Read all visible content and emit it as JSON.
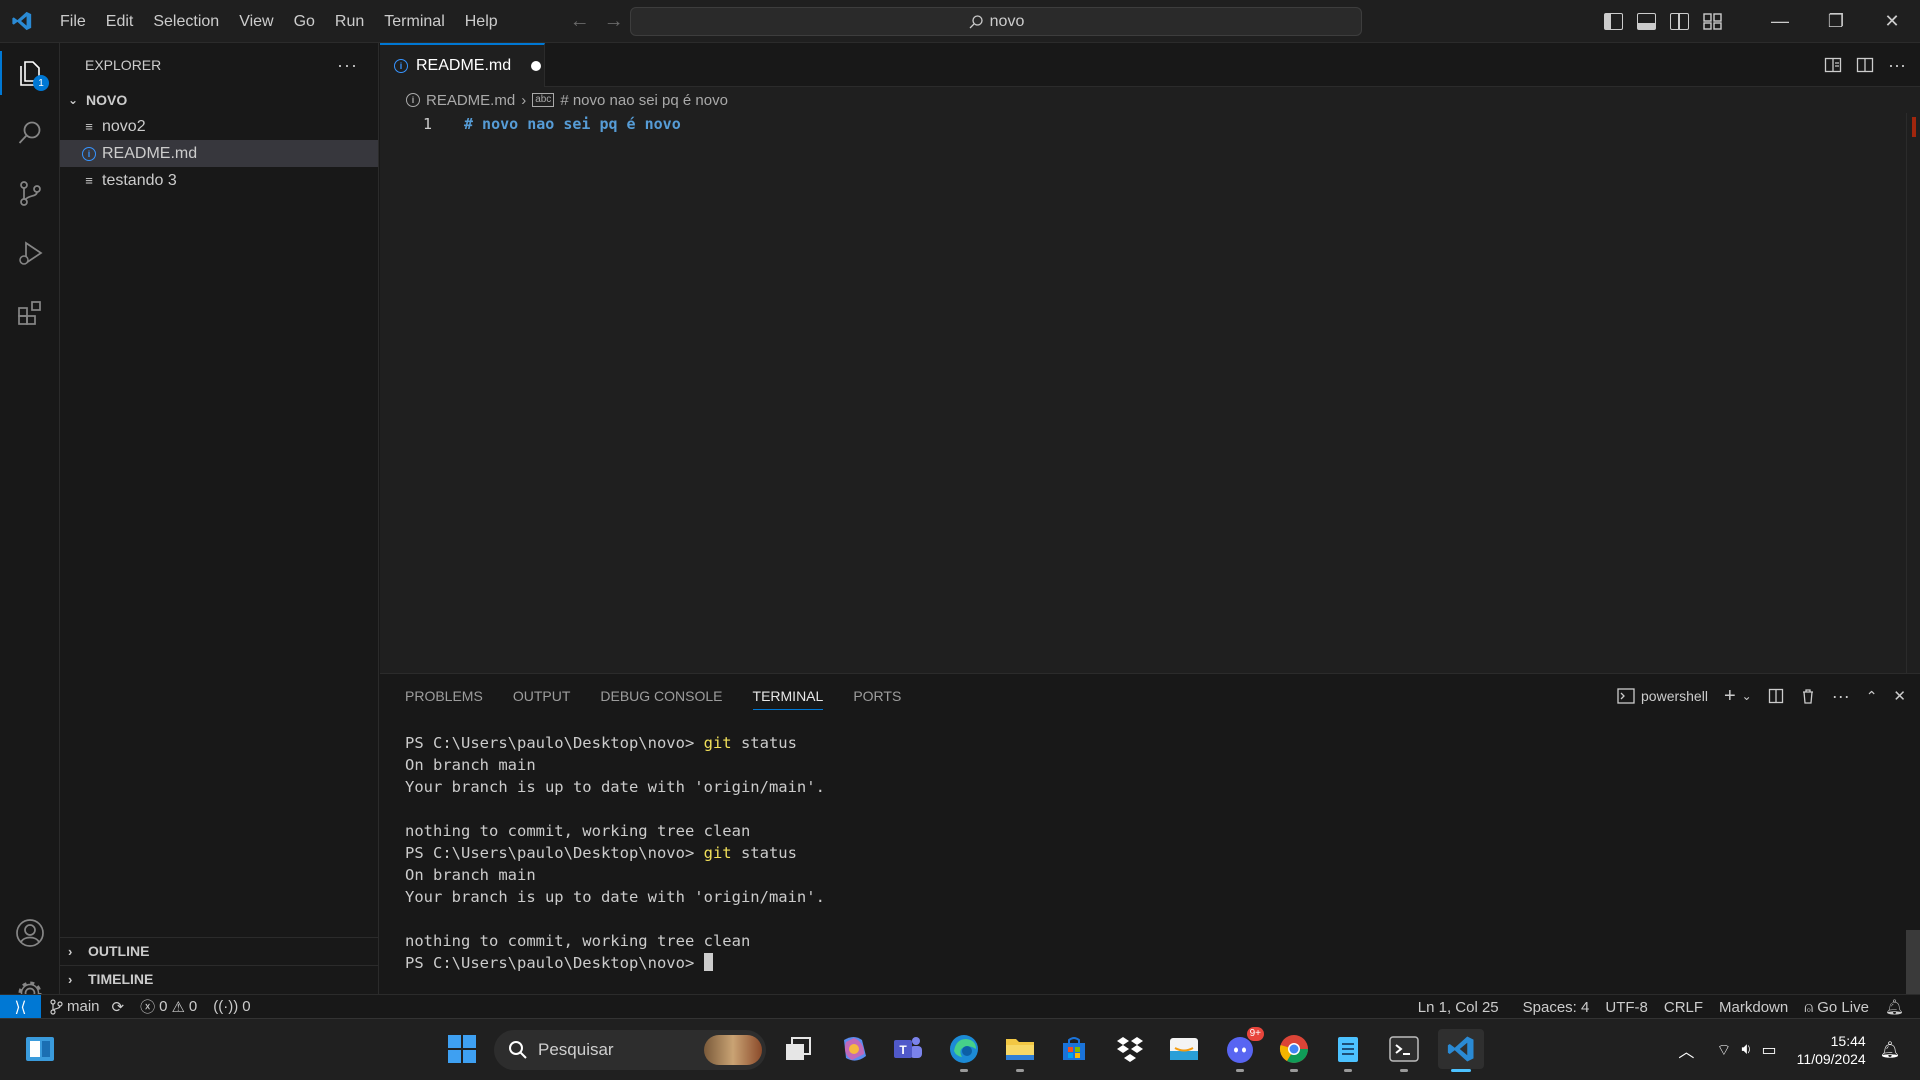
{
  "menu": [
    "File",
    "Edit",
    "Selection",
    "View",
    "Go",
    "Run",
    "Terminal",
    "Help"
  ],
  "command_center": {
    "text": "novo"
  },
  "activity": {
    "explorer_badge": "1"
  },
  "sidebar": {
    "title": "EXPLORER",
    "more": "···",
    "folder": "NOVO",
    "files": [
      {
        "name": "novo2",
        "icon": "lines-file-icon"
      },
      {
        "name": "README.md",
        "icon": "info-icon",
        "selected": true
      },
      {
        "name": "testando 3",
        "icon": "lines-file-icon"
      }
    ],
    "outline": "OUTLINE",
    "timeline": "TIMELINE"
  },
  "editor": {
    "tab_label": "README.md",
    "breadcrumb_file": "README.md",
    "breadcrumb_symbol": "# novo nao sei pq é novo",
    "lines": [
      {
        "no": "1",
        "text": "# novo nao sei pq é novo"
      }
    ]
  },
  "panel": {
    "tabs": [
      "PROBLEMS",
      "OUTPUT",
      "DEBUG CONSOLE",
      "TERMINAL",
      "PORTS"
    ],
    "active_tab": "TERMINAL",
    "shell": "powershell",
    "terminal": [
      {
        "prompt": "PS C:\\Users\\paulo\\Desktop\\novo> ",
        "cmd": "git status"
      },
      {
        "out": "On branch main"
      },
      {
        "out": "Your branch is up to date with 'origin/main'."
      },
      {
        "out": ""
      },
      {
        "out": "nothing to commit, working tree clean"
      },
      {
        "prompt": "PS C:\\Users\\paulo\\Desktop\\novo> ",
        "cmd": "git status"
      },
      {
        "out": "On branch main"
      },
      {
        "out": "Your branch is up to date with 'origin/main'."
      },
      {
        "out": ""
      },
      {
        "out": "nothing to commit, working tree clean"
      },
      {
        "prompt": "PS C:\\Users\\paulo\\Desktop\\novo> ",
        "cmd": "",
        "cursor": true
      }
    ]
  },
  "status": {
    "branch": "main",
    "errors": "0",
    "warnings": "0",
    "ports": "0",
    "position": "Ln 1, Col 25",
    "spaces": "Spaces: 4",
    "encoding": "UTF-8",
    "eol": "CRLF",
    "language": "Markdown",
    "golive": "Go Live"
  },
  "taskbar": {
    "search_placeholder": "Pesquisar",
    "discord_badge": "9+",
    "time": "15:44",
    "date": "11/09/2024"
  },
  "colors": {
    "accent": "#0078d4",
    "heading": "#569cd6",
    "command": "#f1e05a"
  }
}
